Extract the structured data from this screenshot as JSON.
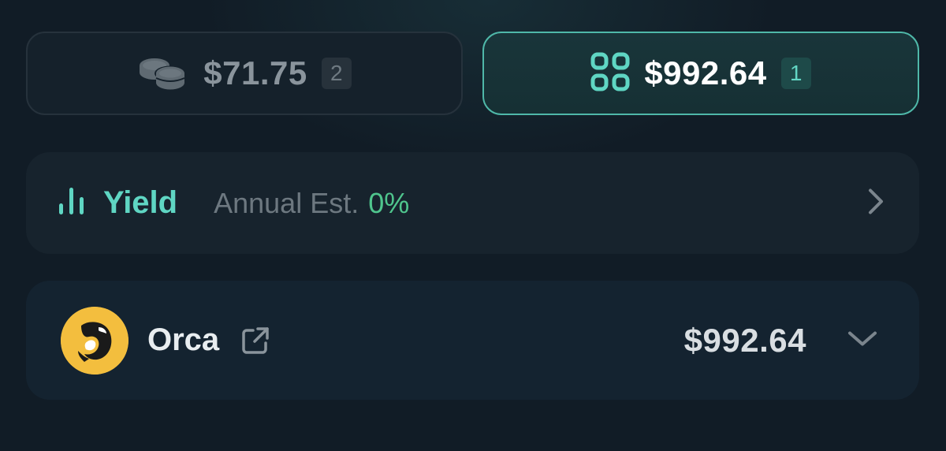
{
  "tabs": [
    {
      "amount": "$71.75",
      "count": "2",
      "icon": "coins-icon",
      "active": false
    },
    {
      "amount": "$992.64",
      "count": "1",
      "icon": "grid-icon",
      "active": true
    }
  ],
  "yield": {
    "title": "Yield",
    "estimate_label": "Annual Est.",
    "estimate_value": "0%",
    "icon": "bar-chart-icon"
  },
  "positions": [
    {
      "name": "Orca",
      "value": "$992.64",
      "logo": "orca-logo",
      "link_icon": "external-link-icon"
    }
  ],
  "colors": {
    "accent": "#5fd6c3",
    "accent_border": "#4fb8a9",
    "positive": "#4fc58d",
    "background": "#111c26",
    "orca_yellow": "#f3be3e"
  }
}
